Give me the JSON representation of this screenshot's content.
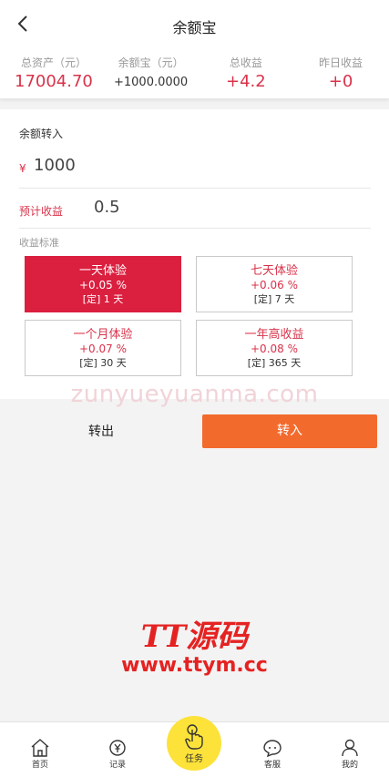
{
  "header": {
    "title": "余额宝",
    "back_icon": "chevron-left-icon"
  },
  "stats": [
    {
      "label": "总资产（元）",
      "value": "17004.70"
    },
    {
      "label": "余额宝（元）",
      "value": "+1000.0000"
    },
    {
      "label": "总收益",
      "value": "+4.2"
    },
    {
      "label": "昨日收益",
      "value": "+0"
    }
  ],
  "form": {
    "section_title": "余额转入",
    "currency_symbol": "¥",
    "amount": "1000",
    "estimate_label": "预计收益",
    "estimate_value": "0.5",
    "standard_label": "收益标准"
  },
  "options": [
    {
      "name": "一天体验",
      "rate": "+0.05 %",
      "term": "[定] 1 天",
      "selected": true
    },
    {
      "name": "七天体验",
      "rate": "+0.06 %",
      "term": "[定] 7 天",
      "selected": false
    },
    {
      "name": "一个月体验",
      "rate": "+0.07 %",
      "term": "[定] 30 天",
      "selected": false
    },
    {
      "name": "一年高收益",
      "rate": "+0.08 %",
      "term": "[定] 365 天",
      "selected": false
    }
  ],
  "watermark": "zunyueyuanma.com",
  "actions": {
    "out_label": "转出",
    "in_label": "转入"
  },
  "brand_watermark": {
    "line1": "TT源码",
    "line2": "www.ttym.cc"
  },
  "tabs": [
    {
      "label": "首页",
      "icon": "home-icon"
    },
    {
      "label": "记录",
      "icon": "record-icon"
    },
    {
      "label": "任务",
      "icon": "tap-hand-icon"
    },
    {
      "label": "客服",
      "icon": "chat-icon"
    },
    {
      "label": "我的",
      "icon": "user-icon"
    }
  ],
  "colors": {
    "accent": "#db1f3f",
    "primary_button": "#f26a2c",
    "task_button": "#fde23a"
  }
}
